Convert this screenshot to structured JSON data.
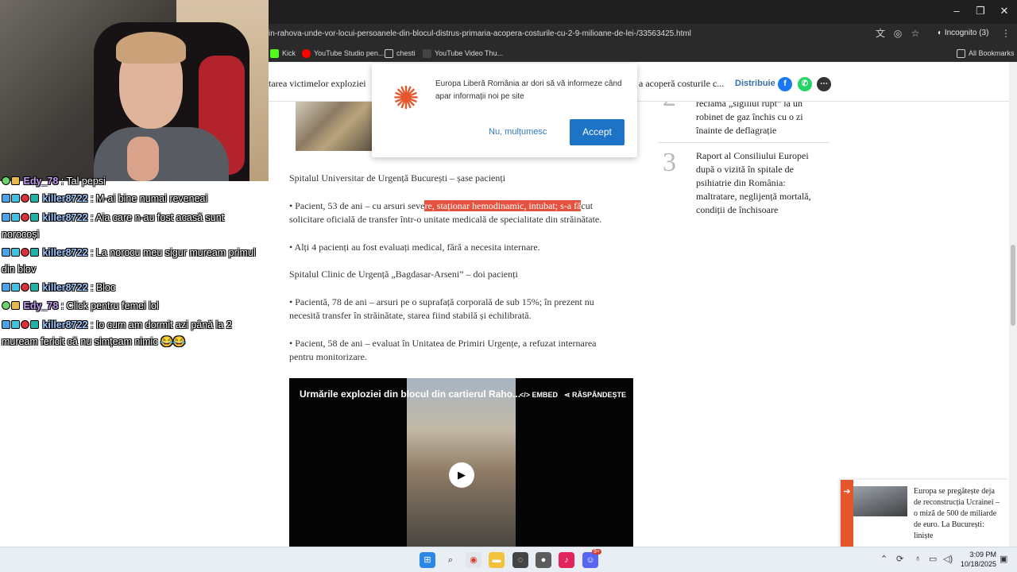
{
  "browser": {
    "url": "in-rahova-unde-vor-locui-persoanele-din-blocul-distrus-primaria-acopera-costurile-cu-2-9-milioane-de-lei-/33563425.html",
    "incognito": "Incognito (3)",
    "window_controls": {
      "minimize": "–",
      "restore": "❐",
      "close": "✕"
    },
    "bookmarks": [
      "Kick",
      "YouTube Studio pen...",
      "chesti",
      "YouTube Video Thu..."
    ],
    "all_bookmarks": "All Bookmarks"
  },
  "sticky_bar": {
    "left_title": "tarea victimelor exploziei",
    "right_title": "a acoperă costurile c...",
    "share_label": "Distribuie"
  },
  "notification": {
    "message": "Europa Liberă România ar dori să vă informeze când apar informații noi pe site",
    "decline": "Nu, mulțumesc",
    "accept": "Accept"
  },
  "article": {
    "hospital1": "Spitalul Universitar de Urgență București – șase pacienți",
    "p1_before": "• Pacient, 53 de ani – cu arsuri seve",
    "p1_highlight": "re, staționar hemodinamic, intubat; s-a fă",
    "p1_after": "cut",
    "p1_line2": "solicitare oficială de transfer într-o unitate medicală de specialitate din străinătate.",
    "p2": "• Alți 4 pacienți au fost evaluați medical, fără a necesita internare.",
    "hospital2": "Spitalul Clinic de Urgență „Bagdasar-Arseni” – doi pacienți",
    "p3_line1": "• Pacientă, 78 de ani – arsuri pe o suprafață corporală de sub 15%; în prezent nu",
    "p3_line2": "necesită transfer în străinătate, starea fiind stabilă și echilibrată.",
    "p4_line1": "• Pacient, 58 de ani – evaluat în Unitatea de Primiri Urgențe, a refuzat internarea",
    "p4_line2": "pentru monitorizare."
  },
  "video": {
    "title": "Urmările exploziei din blocul din cartierul Raho...",
    "embed": "EMBED",
    "share": "RĂSPÂNDEȘTE"
  },
  "sidebar": {
    "item2_rank": "2",
    "item2_lines": [
      "reclamă „sigiliul rupt” la un",
      "robinet de gaz închis cu o zi",
      "înainte de deflagrație"
    ],
    "item3_rank": "3",
    "item3_lines": [
      "Raport al Consiliului Europei",
      "după o vizită în spitale de",
      "psihiatrie din România:",
      "maltratare, neglijență mortală,",
      "condiții de închisoare"
    ]
  },
  "popup": {
    "lines": [
      "Europa se pregătește deja",
      "de reconstrucția Ucrainei –",
      "o miză de 500 de miliarde",
      "de euro. La București:",
      "liniște"
    ]
  },
  "chat": [
    {
      "user": "Edy_78",
      "msg": ": Tal pepsi"
    },
    {
      "user": "killer8722",
      "msg": ": M-ai bine numai reveneai"
    },
    {
      "user": "killer8722",
      "msg": ": Aia care n-au fost acasă sunt norocoși"
    },
    {
      "user": "killer8722",
      "msg": ": La norocu meu sigur muream primul din blov"
    },
    {
      "user": "killer8722",
      "msg": ": Bloc"
    },
    {
      "user": "Edy_78",
      "msg": ": Click pentru femei lol"
    },
    {
      "user": "killer8722",
      "msg": ": Io cum am dormit azi până la 2 muream fericit că nu simțeam nimic 😂😂"
    }
  ],
  "taskbar": {
    "time": "3:09 PM",
    "date": "10/18/2025",
    "discord_badge": "9+"
  },
  "colors": {
    "accent": "#e6562d",
    "link": "#2f77c1",
    "accept": "#1d74c6",
    "highlight": "#e55340"
  }
}
